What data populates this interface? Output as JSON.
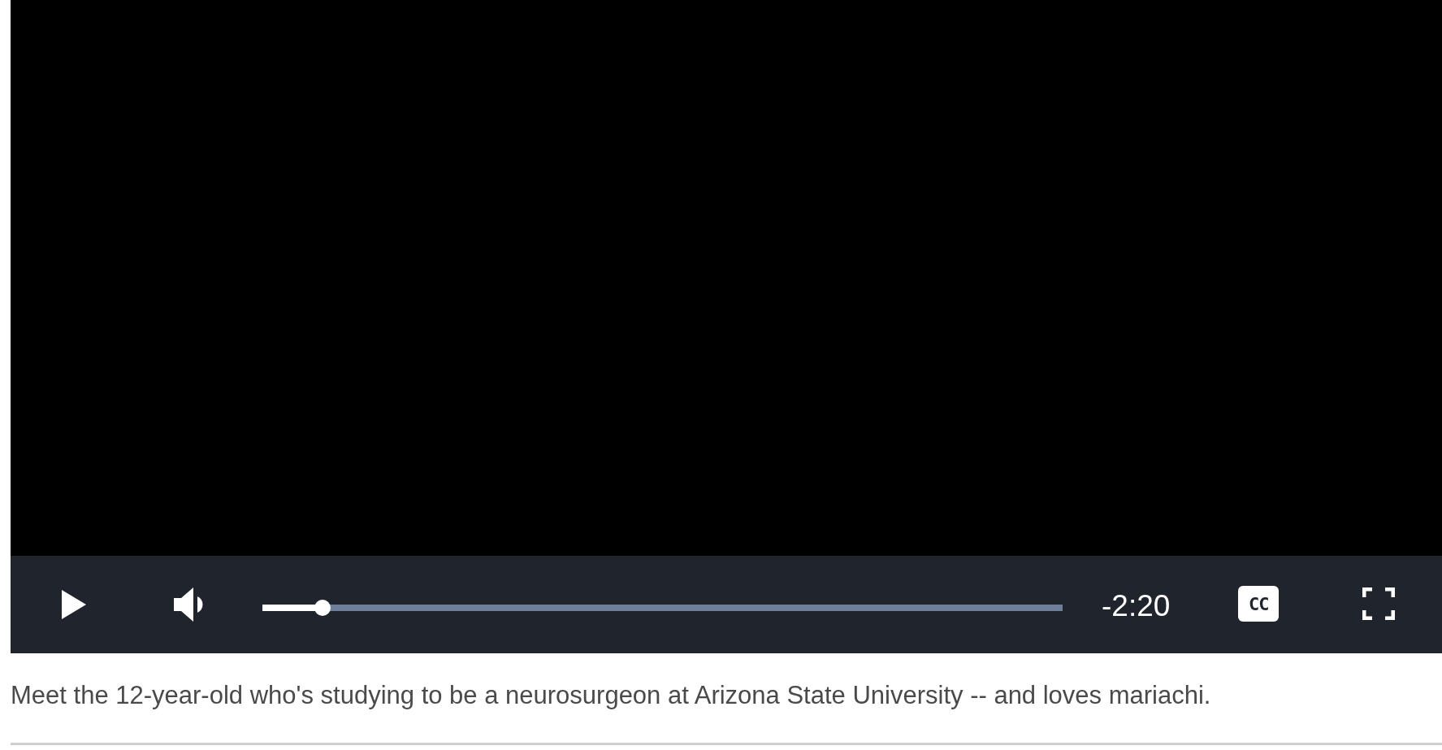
{
  "player": {
    "progress": {
      "level": 0.075
    },
    "time_remaining": "-2:20",
    "captions_label": "CC"
  },
  "caption": "Meet the 12-year-old who's studying to be a neurosurgeon at Arizona State University -- and loves mariachi."
}
